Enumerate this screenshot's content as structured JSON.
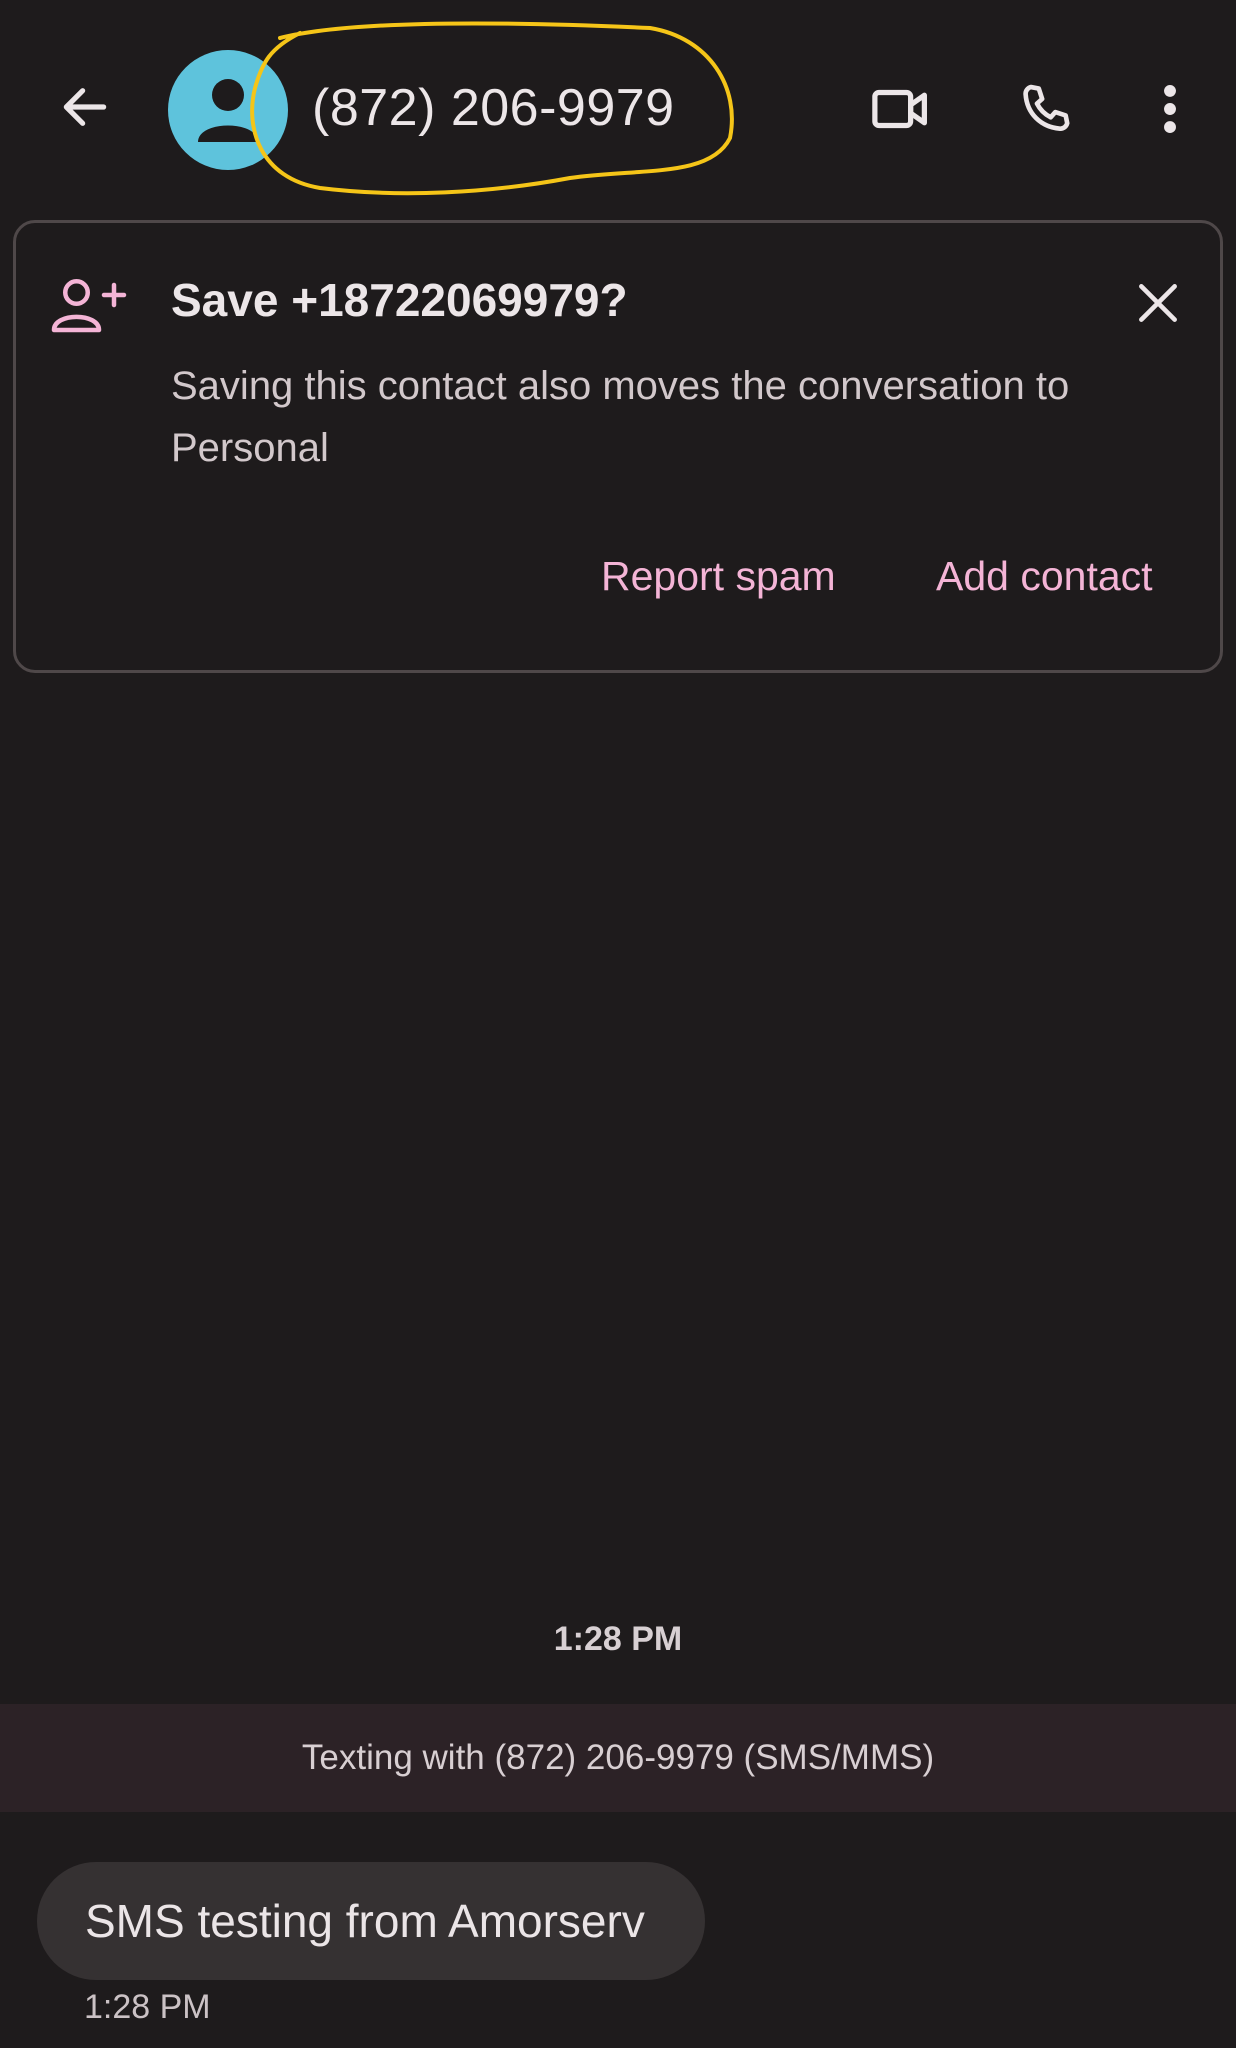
{
  "colors": {
    "background": "#1e1b1c",
    "accent": "#f4b4d6",
    "avatar": "#5ec3dc",
    "annotation": "#f5c518"
  },
  "header": {
    "title": "(872) 206-9979",
    "icons": {
      "back": "arrow-back-icon",
      "avatar": "person-icon",
      "video": "video-call-icon",
      "call": "phone-icon",
      "more": "more-vert-icon"
    }
  },
  "save_card": {
    "icon": "person-add-icon",
    "title": "Save +18722069979?",
    "description": "Saving this contact also moves the conversation to Personal",
    "report_spam_label": "Report spam",
    "add_contact_label": "Add contact",
    "close_icon": "close-icon"
  },
  "conversation": {
    "timestamp": "1:28 PM",
    "banner_text": "Texting with (872) 206-9979 (SMS/MMS)",
    "messages": [
      {
        "text": "SMS testing from Amorserv",
        "time": "1:28 PM"
      }
    ]
  }
}
